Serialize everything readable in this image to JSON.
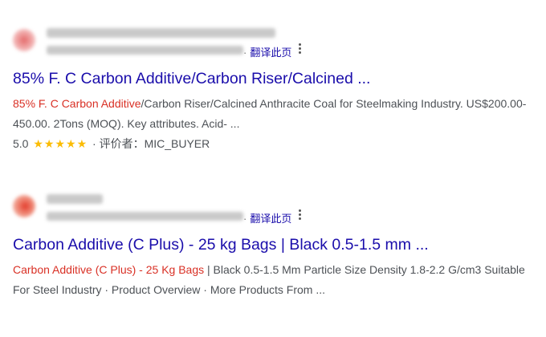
{
  "results": [
    {
      "translate_label": "翻译此页",
      "title": "85% F. C Carbon Additive/Carbon Riser/Calcined ...",
      "snippet_highlight": "85% F. C Carbon Additive",
      "snippet_rest": "/Carbon Riser/Calcined Anthracite Coal for Steelmaking Industry. US$200.00-450.00. 2Tons (MOQ). Key attributes. Acid- ...",
      "rating_value": "5.0",
      "stars": "★★★★★",
      "rating_suffix": " · 评价者：MIC_BUYER"
    },
    {
      "translate_label": "翻译此页",
      "title": "Carbon Additive (C Plus) - 25 kg Bags | Black 0.5-1.5 mm ...",
      "snippet_highlight": "Carbon Additive (C Plus) - 25 Kg Bags",
      "snippet_rest": " | Black 0.5-1.5 Mm Particle Size Density 1.8-2.2 G/cm3 Suitable For Steel Industry · Product Overview · More Products From ..."
    }
  ],
  "colors": {
    "link": "#1a0dab",
    "highlight": "#d93025",
    "star": "#fbbc04",
    "text": "#4d5156"
  },
  "icons": [
    "site-favicon",
    "more-options-icon"
  ]
}
